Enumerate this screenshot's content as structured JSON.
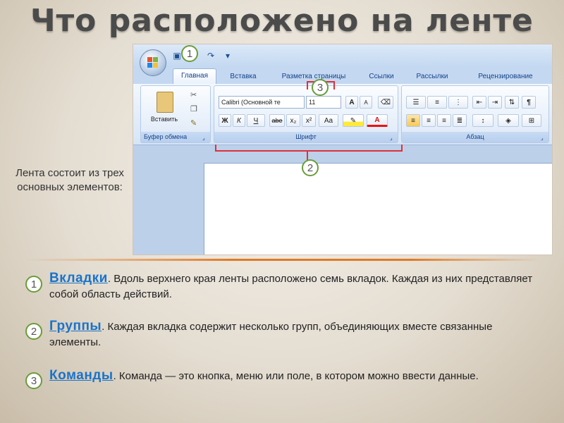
{
  "title": "Что расположено на ленте",
  "side_text": "Лента состоит из трех основных элементов:",
  "screenshot": {
    "tabs": [
      "Главная",
      "Вставка",
      "Разметка страницы",
      "Ссылки",
      "Рассылки",
      "Рецензирование"
    ],
    "active_tab": "Главная",
    "groups": {
      "clipboard": {
        "label": "Буфер обмена",
        "paste": "Вставить"
      },
      "font": {
        "label": "Шрифт",
        "font_name": "Calibri (Основной те",
        "font_size": "11",
        "grow": "A",
        "shrink": "A",
        "bold": "Ж",
        "italic": "К",
        "underline": "Ч",
        "strike": "abe",
        "sub": "x₂",
        "sup": "x²",
        "case": "Aa",
        "color_letter": "A"
      },
      "paragraph": {
        "label": "Абзац",
        "pilcrow": "¶"
      }
    },
    "callouts": [
      "1",
      "2",
      "3"
    ]
  },
  "items": [
    {
      "num": "1",
      "keyword": "Вкладки",
      "text": ". Вдоль верхнего края ленты расположено семь вкладок. Каждая из них представляет собой область действий."
    },
    {
      "num": "2",
      "keyword": "Группы",
      "text": ". Каждая вкладка содержит несколько групп, объединяющих вместе связанные элементы."
    },
    {
      "num": "3",
      "keyword": "Команды",
      "text": ". Команда — это кнопка, меню или поле, в котором можно ввести данные."
    }
  ],
  "colors": {
    "accent": "#1a73c9",
    "divider": "#e07a24",
    "callout": "#e0303a",
    "badge": "#6a9c39"
  }
}
